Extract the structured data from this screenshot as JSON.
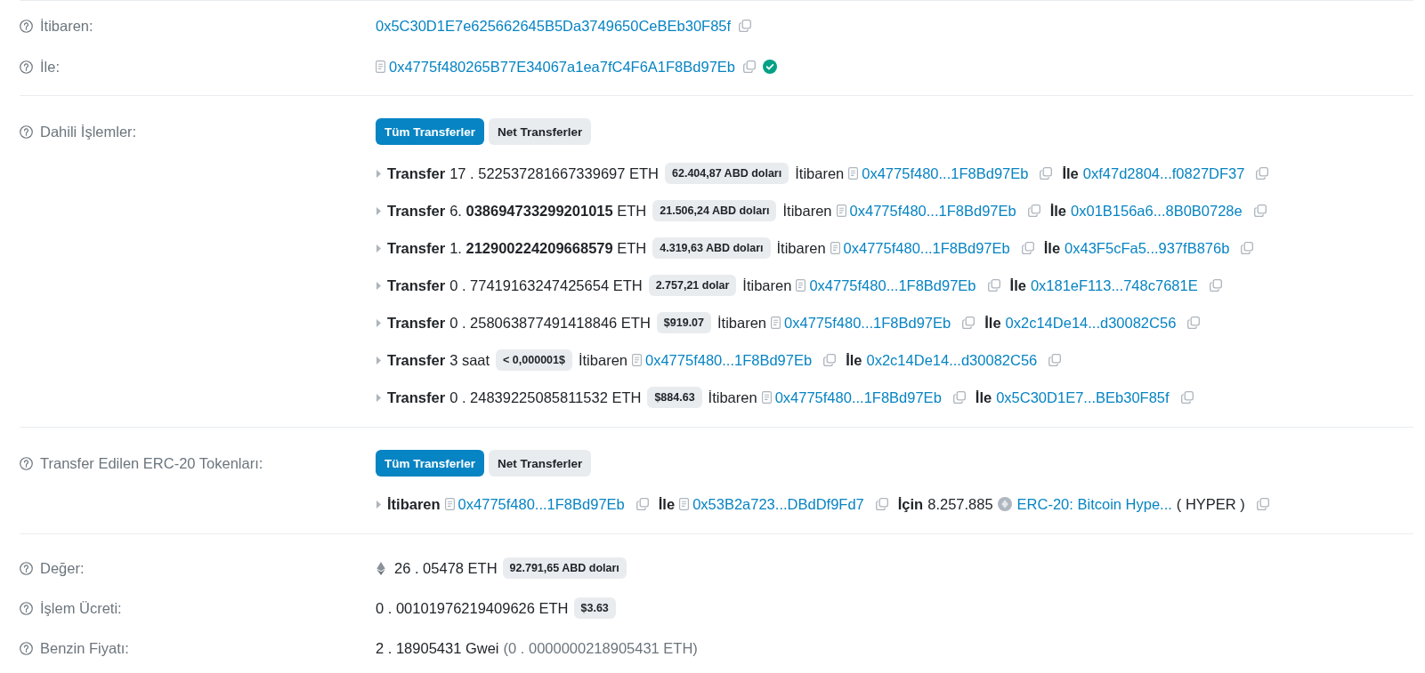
{
  "header_rows": [
    {
      "label": "İtibaren:",
      "address": "0x5C30D1E7e625662645B5Da3749650CeBEb30F85f",
      "contract": false,
      "verified": false
    },
    {
      "label": "İle:",
      "address": "0x4775f480265B77E34067a1ea7fC4F6A1F8Bd97Eb",
      "contract": true,
      "verified": true
    }
  ],
  "internal_transactions": {
    "label": "Dahili İşlemler:",
    "tabs": [
      {
        "label": "Tüm Transferler",
        "selected": true
      },
      {
        "label": "Net Transferler",
        "selected": false
      }
    ],
    "rows": [
      {
        "expanded": false,
        "title": "Transfer",
        "amount": "17 . 522537281667339697 ETH",
        "usd": "62.404,87 ABD doları",
        "from_label": "İtibaren",
        "from": {
          "address": "0x4775f480...1F8Bd97Eb",
          "contract": true
        },
        "to_label": "İle",
        "to": {
          "address": "0xf47d2804...f0827DF37",
          "contract": false
        }
      },
      {
        "expanded": false,
        "title": "Transfer",
        "amount": "6. **038694733299201015** ETH",
        "usd": "21.506,24 ABD doları",
        "from_label": "İtibaren",
        "from": {
          "address": "0x4775f480...1F8Bd97Eb",
          "contract": true
        },
        "to_label": "İle",
        "to": {
          "address": "0x01B156a6...8B0B0728e",
          "contract": false
        }
      },
      {
        "expanded": false,
        "title": "Transfer",
        "amount": "1. **212900224209668579** ETH",
        "usd": "4.319,63 ABD doları",
        "from_label": "İtibaren",
        "from": {
          "address": "0x4775f480...1F8Bd97Eb",
          "contract": true
        },
        "to_label": "İle",
        "to": {
          "address": "0x43F5cFa5...937fB876b",
          "contract": false
        }
      },
      {
        "expanded": false,
        "title": "Transfer",
        "amount": "0 . 77419163247425654 ETH",
        "usd": "2.757,21 dolar",
        "from_label": "İtibaren",
        "from": {
          "address": "0x4775f480...1F8Bd97Eb",
          "contract": true
        },
        "to_label": "İle",
        "to": {
          "address": "0x181eF113...748c7681E",
          "contract": false
        }
      },
      {
        "expanded": false,
        "title": "Transfer",
        "amount": "0 . 258063877491418846 ETH",
        "usd": "$919.07",
        "from_label": "İtibaren",
        "from": {
          "address": "0x4775f480...1F8Bd97Eb",
          "contract": true
        },
        "to_label": "İle",
        "to": {
          "address": "0x2c14De14...d30082C56",
          "contract": false
        }
      },
      {
        "expanded": false,
        "title": "Transfer",
        "amount": "3 saat",
        "usd": "< 0,000001$",
        "from_label": "İtibaren",
        "from": {
          "address": "0x4775f480...1F8Bd97Eb",
          "contract": true
        },
        "to_label": "İle",
        "to": {
          "address": "0x2c14De14...d30082C56",
          "contract": false
        }
      },
      {
        "expanded": false,
        "title": "Transfer",
        "amount": "0 . 24839225085811532 ETH",
        "usd": "$884.63",
        "from_label": "İtibaren",
        "from": {
          "address": "0x4775f480...1F8Bd97Eb",
          "contract": true
        },
        "to_label": "İle",
        "to": {
          "address": "0x5C30D1E7...BEb30F85f",
          "contract": false
        }
      }
    ]
  },
  "erc20_transfers": {
    "label": "Transfer Edilen ERC-20 Tokenları:",
    "tabs": [
      {
        "label": "Tüm Transferler",
        "selected": true
      },
      {
        "label": "Net Transferler",
        "selected": false
      }
    ],
    "rows": [
      {
        "expanded": false,
        "from_label": "İtibaren",
        "from": {
          "address": "0x4775f480...1F8Bd97Eb",
          "contract": true
        },
        "to_label": "İle",
        "to": {
          "address": "0x53B2a723...DBdDf9Fd7",
          "contract": true
        },
        "for_label": "İçin",
        "amount": "8.257.885",
        "token": "ERC-20: Bitcoin Hype...",
        "symbol": "( HYPER )"
      }
    ]
  },
  "value": {
    "label": "Değer:",
    "amount": "26 . 05478 ETH",
    "usd": "92.791,65 ABD doları"
  },
  "fee": {
    "label": "İşlem Ücreti:",
    "amount": "0 . 00101976219409626 ETH",
    "usd": "$3.63"
  },
  "gas_price": {
    "label": "Benzin Fiyatı:",
    "amount": "2 . 18905431 Gwei",
    "detail": "(0 . 0000000218905431 ETH)"
  }
}
